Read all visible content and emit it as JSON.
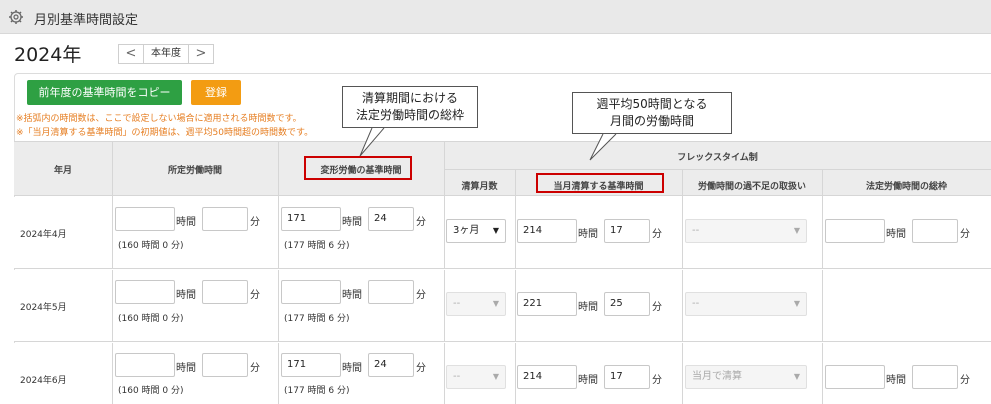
{
  "header": {
    "title": "月別基準時間設定",
    "icon": "gear-icon"
  },
  "year": {
    "label": "2024年",
    "current_button": "本年度",
    "prev": "<",
    "next": ">"
  },
  "actions": {
    "copy_label": "前年度の基準時間をコピー",
    "register_label": "登録"
  },
  "notes": [
    "※括弧内の時間数は、ここで設定しない場合に適用される時間数です。",
    "※「当月清算する基準時間」の初期値は、週平均50時間超の時間数です。"
  ],
  "callouts": {
    "left": {
      "line1": "清算期間における",
      "line2": "法定労働時間の総枠"
    },
    "right": {
      "line1": "週平均50時間となる",
      "line2": "月間の労働時間"
    }
  },
  "table": {
    "headers": {
      "year_month": "年月",
      "prescribed": "所定労働時間",
      "variable": "変形労働の基準時間",
      "flex": "フレックスタイム制",
      "settle_months": "清算月数",
      "monthly_base": "当月清算する基準時間",
      "excess": "労働時間の過不足の取扱い",
      "legal_total": "法定労働時間の総枠"
    },
    "units": {
      "hour": "時間",
      "minute": "分"
    },
    "rows": [
      {
        "month": "2024年4月",
        "prescribed": {
          "h": "",
          "m": "",
          "default": "(160 時間 0 分)"
        },
        "variable": {
          "h": "171",
          "m": "24",
          "default": "(177 時間 6 分)"
        },
        "settle": "3ヶ月",
        "monthly": {
          "h": "214",
          "m": "17"
        },
        "excess": "--",
        "legal": {
          "h": "",
          "m": ""
        }
      },
      {
        "month": "2024年5月",
        "prescribed": {
          "h": "",
          "m": "",
          "default": "(160 時間 0 分)"
        },
        "variable": {
          "h": "",
          "m": "",
          "default": "(177 時間 6 分)"
        },
        "settle": "--",
        "monthly": {
          "h": "221",
          "m": "25"
        },
        "excess": "--",
        "legal": null
      },
      {
        "month": "2024年6月",
        "prescribed": {
          "h": "",
          "m": "",
          "default": "(160 時間 0 分)"
        },
        "variable": {
          "h": "171",
          "m": "24",
          "default": "(177 時間 6 分)"
        },
        "settle": "--",
        "monthly": {
          "h": "214",
          "m": "17"
        },
        "excess": "当月で清算",
        "legal": {
          "h": "",
          "m": ""
        }
      }
    ]
  },
  "colors": {
    "copy_button": "#2ea043",
    "register_button": "#f39c12",
    "note": "#e67e22",
    "highlight": "#cc0000"
  }
}
